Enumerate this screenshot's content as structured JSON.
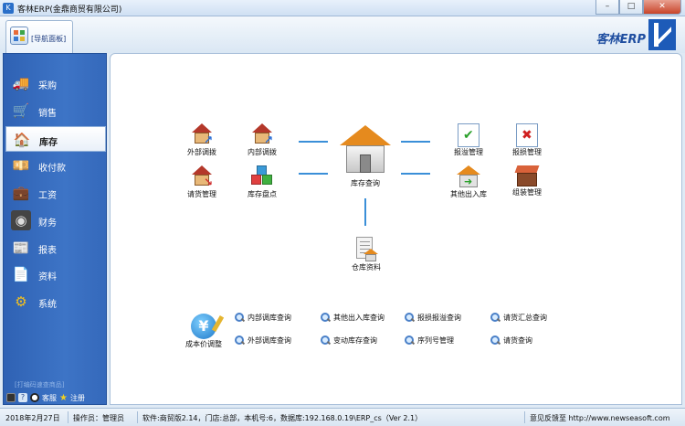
{
  "window": {
    "title": "客林ERP(金鼎商贸有限公司)",
    "min_glyph": "–",
    "max_glyph": "□",
    "close_glyph": "✕"
  },
  "header": {
    "nav_tab_label": "[导航面板]",
    "brand_text": "客林ERP"
  },
  "sidebar": {
    "items": [
      {
        "label": "采购",
        "icon": "truck-icon",
        "glyph": "🚚",
        "color": "#4a90d8"
      },
      {
        "label": "销售",
        "icon": "cart-icon",
        "glyph": "🛒",
        "color": "#7aa0c8"
      },
      {
        "label": "库存",
        "icon": "house-icon",
        "glyph": "🏠",
        "color": "#d84a2a",
        "active": true
      },
      {
        "label": "收付款",
        "icon": "money-icon",
        "glyph": "💴",
        "color": "#4aa84a"
      },
      {
        "label": "工资",
        "icon": "wallet-icon",
        "glyph": "💼",
        "color": "#c8902a"
      },
      {
        "label": "财务",
        "icon": "safe-icon",
        "glyph": "◉",
        "color": "#555555"
      },
      {
        "label": "报表",
        "icon": "report-icon",
        "glyph": "📰",
        "color": "#e8e8e8"
      },
      {
        "label": "资料",
        "icon": "document-icon",
        "glyph": "📄",
        "color": "#f0f0f0"
      },
      {
        "label": "系统",
        "icon": "gear-icon",
        "glyph": "⚙",
        "color": "#e8b020"
      }
    ],
    "promo_text": "[打编码速查商品]",
    "bottom": {
      "support_label": "客服",
      "register_label": "注册"
    }
  },
  "workflow": {
    "external_transfer": "外部调拨",
    "internal_transfer": "内部调拨",
    "request_goods": "请货管理",
    "stocktake": "库存盘点",
    "inventory_query": "库存查询",
    "overflow_mgmt": "报溢管理",
    "damage_mgmt": "报损管理",
    "other_inout": "其他出入库",
    "assembly_mgmt": "组装管理",
    "warehouse_info": "仓库资料",
    "cost_adjust": "成本价调整"
  },
  "quick_links": [
    "内部调库查询",
    "其他出入库查询",
    "报损报溢查询",
    "请货汇总查询",
    "外部调库查询",
    "变动库存查询",
    "序列号管理",
    "请货查询"
  ],
  "statusbar": {
    "date": "2018年2月27日",
    "operator": "操作员：管理员",
    "info": "软件:商贸版2.14，门店:总部，本机号:6，数据库:192.168.0.19\\ERP_cs（Ver 2.1）",
    "feedback": "意见反馈至 http://www.newseasoft.com"
  }
}
